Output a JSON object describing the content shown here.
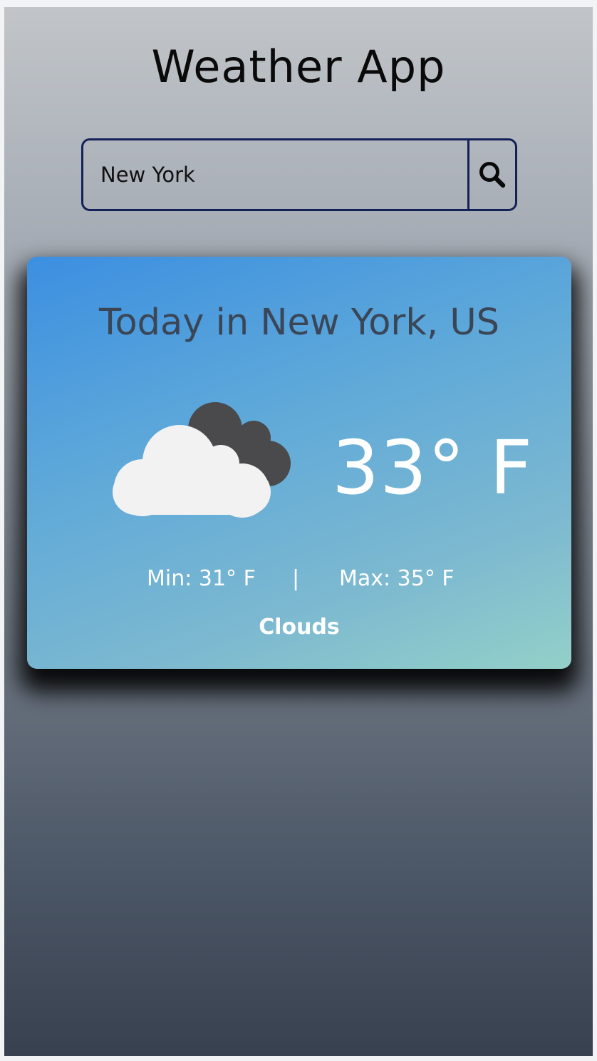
{
  "app": {
    "title": "Weather App"
  },
  "search": {
    "value": "New York",
    "placeholder": "",
    "button_icon": "search-icon"
  },
  "weather": {
    "location": "Today in New York, US",
    "temperature": "33° F",
    "min": "Min: 31° F",
    "divider": "|",
    "max": "Max: 35° F",
    "condition": "Clouds",
    "icon": "clouds-icon"
  },
  "colors": {
    "card_gradient_start": "#3c8fe1",
    "card_gradient_end": "#93d0c8",
    "search_border": "#132158",
    "cloud_front": "#f2f2f2",
    "cloud_back": "#4a4a4d"
  }
}
